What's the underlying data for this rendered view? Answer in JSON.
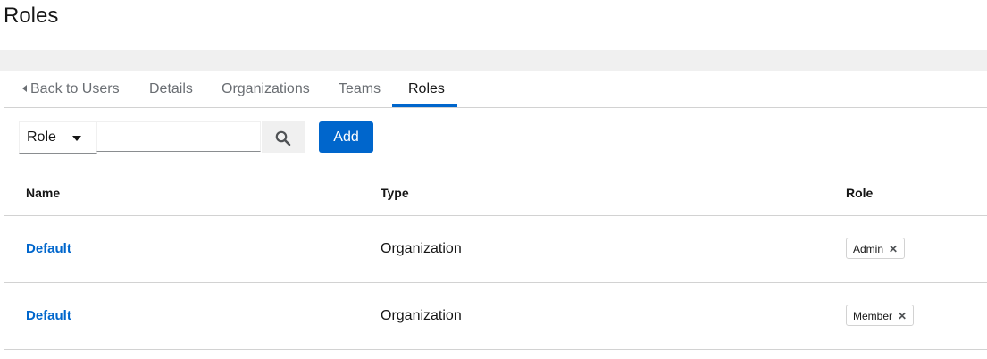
{
  "page": {
    "title": "Roles"
  },
  "tabs": [
    {
      "label": "Back to Users",
      "back": true
    },
    {
      "label": "Details"
    },
    {
      "label": "Organizations"
    },
    {
      "label": "Teams"
    },
    {
      "label": "Roles",
      "active": true
    }
  ],
  "toolbar": {
    "filter_select_value": "Role",
    "search_value": "",
    "add_label": "Add",
    "search_icon": "search-icon"
  },
  "table": {
    "columns": [
      "Name",
      "Type",
      "Role"
    ],
    "rows": [
      {
        "name": "Default",
        "type": "Organization",
        "role": "Admin"
      },
      {
        "name": "Default",
        "type": "Organization",
        "role": "Member"
      }
    ]
  },
  "colors": {
    "accent": "#0066cc",
    "link": "#0066cc"
  }
}
